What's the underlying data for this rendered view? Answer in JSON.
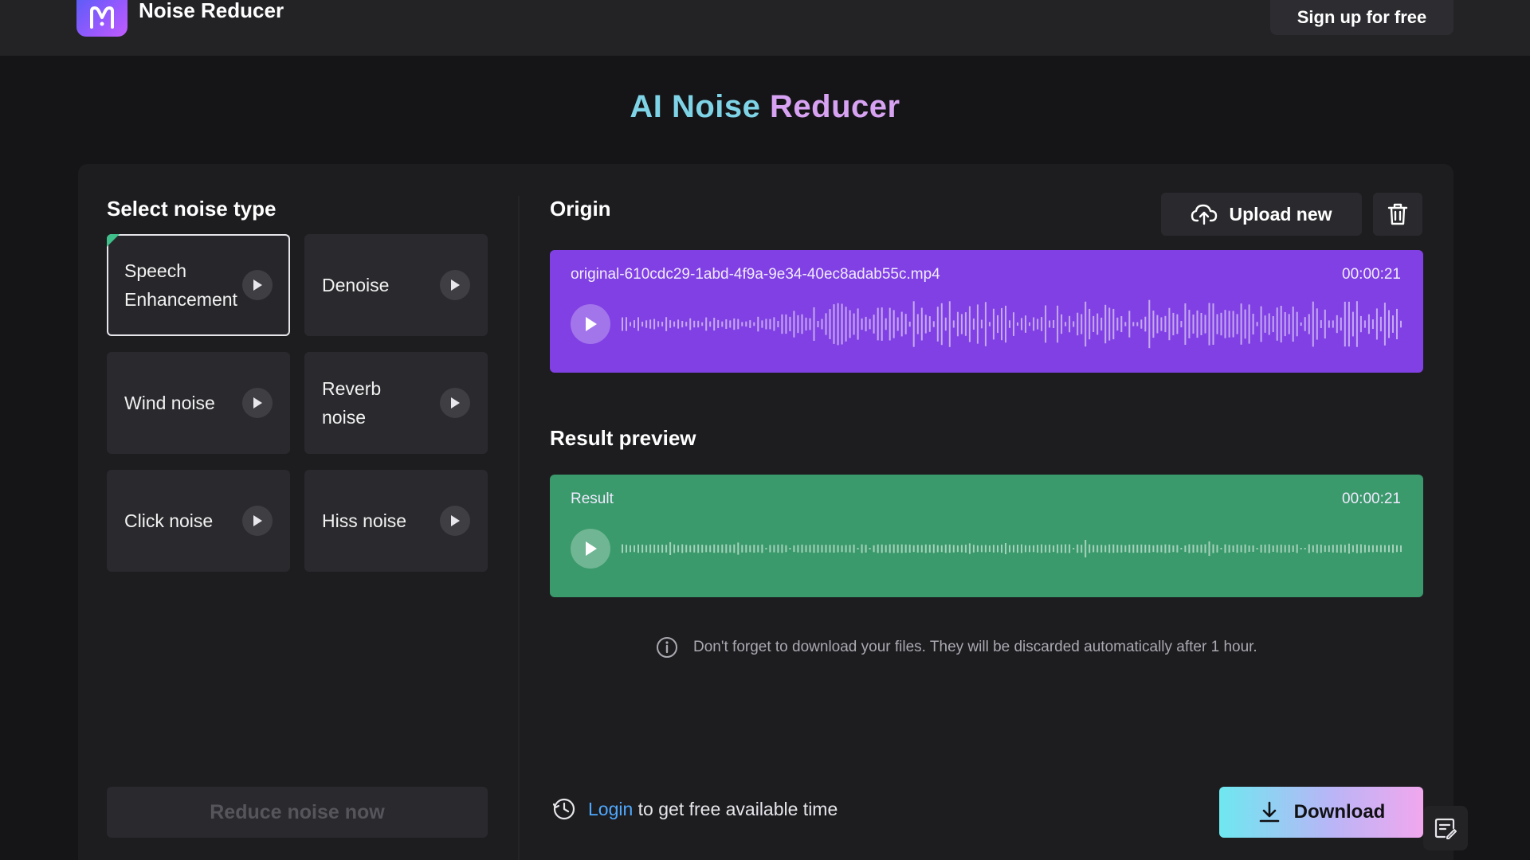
{
  "header": {
    "brand_name": "Noise Reducer",
    "signup_label": "Sign up for free"
  },
  "title": {
    "part_a": "AI Noise",
    "part_b": "Reducer"
  },
  "noise_panel": {
    "heading": "Select noise type",
    "items": [
      {
        "label": "Speech Enhancement",
        "selected": true
      },
      {
        "label": "Denoise",
        "selected": false
      },
      {
        "label": "Wind noise",
        "selected": false
      },
      {
        "label": "Reverb noise",
        "selected": false
      },
      {
        "label": "Click noise",
        "selected": false
      },
      {
        "label": "Hiss noise",
        "selected": false
      }
    ],
    "reduce_label": "Reduce noise now"
  },
  "origin": {
    "heading": "Origin",
    "upload_label": "Upload new",
    "filename": "original-610cdc29-1abd-4f9a-9e34-40ec8adab55c.mp4",
    "duration": "00:00:21",
    "color": "#8040e3"
  },
  "result": {
    "heading": "Result preview",
    "label": "Result",
    "duration": "00:00:21",
    "color": "#3a9a6b"
  },
  "notice": "Don't forget to download your files. They will be discarded automatically after 1 hour.",
  "login": {
    "link_label": "Login",
    "rest_text": "to get free available time"
  },
  "download_label": "Download",
  "colors": {
    "background": "#151518",
    "topbar": "#232326",
    "card": "#1d1d20",
    "accent_teal": "#7fd3e6",
    "accent_pink": "#d8a2f2",
    "link": "#4fa9ff"
  },
  "icons": [
    "logo-icon",
    "play-icon",
    "upload-cloud-icon",
    "trash-icon",
    "info-icon",
    "clock-icon",
    "download-icon",
    "feedback-icon"
  ]
}
